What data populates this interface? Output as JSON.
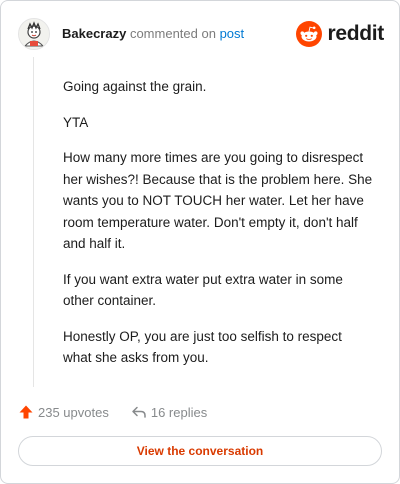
{
  "header": {
    "username": "Bakecrazy",
    "action_text": "commented on",
    "post_link_text": "post",
    "brand_name": "reddit"
  },
  "comment": {
    "paragraphs": [
      "Going against the grain.",
      "YTA",
      "How many more times are you going to disrespect her wishes?! Because that is the problem here. She wants you to NOT TOUCH her water. Let her have room temperature water. Don't empty it, don't half and half it.",
      "If you want extra water put extra water in some other container.",
      "Honestly OP, you are just too selfish to respect what she asks from you."
    ]
  },
  "footer": {
    "upvotes_label": "235 upvotes",
    "replies_label": "16 replies"
  },
  "cta": {
    "label": "View the conversation"
  },
  "icons": {
    "upvote": "upvote-arrow-icon",
    "reply": "reply-arrow-icon",
    "brand": "reddit-snoo-icon",
    "avatar": "user-avatar"
  },
  "colors": {
    "brand_orange": "#ff4500",
    "link_blue": "#0079d3",
    "cta_text": "#d93a00",
    "muted": "#878a8c"
  }
}
